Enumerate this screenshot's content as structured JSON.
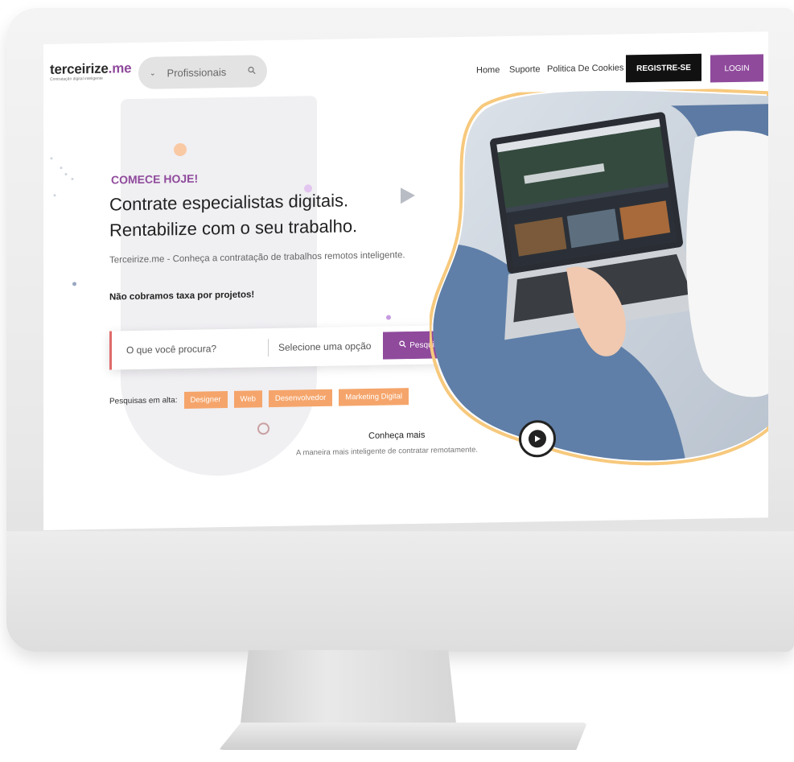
{
  "header": {
    "brand_name": "terceirize",
    "brand_suffix": ".me",
    "tagline": "Contratação digital inteligente",
    "search_pill": {
      "label": "Profissionais",
      "chevron_icon": "chevron-down-icon",
      "search_icon": "search-icon"
    },
    "nav": {
      "home": "Home",
      "suporte": "Suporte",
      "cookies": "Politica De Cookies"
    },
    "register_label": "REGISTRE-SE",
    "login_label": "LOGIN"
  },
  "hero": {
    "eyebrow": "COMECE HOJE!",
    "title_line1": "Contrate especialistas digitais.",
    "title_line2": "Rentabilize com o seu trabalho.",
    "description": "Terceirize.me - Conheça a contratação de trabalhos remotos inteligente.",
    "description_bold": "Não cobramos taxa por projetos!"
  },
  "search": {
    "query_placeholder": "O que você procura?",
    "select_placeholder": "Selecione uma opção",
    "button_label": "Pesquisar",
    "button_icon": "search-icon"
  },
  "trending": {
    "label": "Pesquisas em alta:",
    "chips": [
      "Designer",
      "Web",
      "Desenvolvedor",
      "Marketing Digital"
    ]
  },
  "video": {
    "title": "Conheça mais",
    "subtitle": "A maneira mais inteligente de contratar remotamente.",
    "play_icon": "play-icon"
  },
  "colors": {
    "accent": "#8f4a9c",
    "chip": "#f5a56b",
    "search_border": "#e06b6b",
    "dark": "#111111"
  }
}
